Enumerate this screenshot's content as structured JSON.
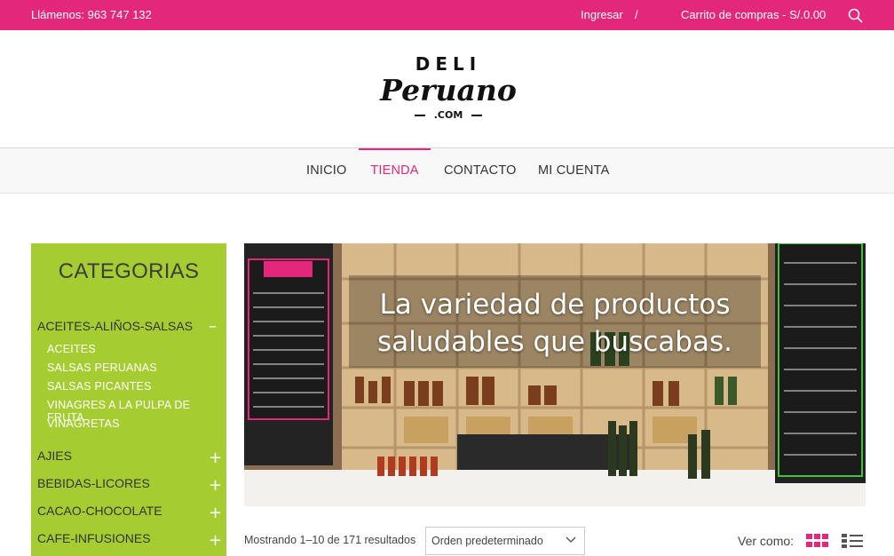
{
  "topbar": {
    "phone": "Llámenos: 963 747 132",
    "login": "Ingresar",
    "separator": "/",
    "cart": "Carrito de compras - S/.0.00",
    "search_icon": "search-icon"
  },
  "logo": {
    "line1": "DELI",
    "line2": "Peruano",
    "line3": ".COM"
  },
  "nav": {
    "items": [
      {
        "label": "INICIO"
      },
      {
        "label": "TIENDA"
      },
      {
        "label": "CONTACTO"
      },
      {
        "label": "MI CUENTA"
      }
    ],
    "active": "TIENDA"
  },
  "sidebar": {
    "title": "CATEGORIAS",
    "categories": [
      {
        "label": "ACEITES-ALIÑOS-SALSAS",
        "toggle": "–",
        "expanded": true,
        "subs": [
          "ACEITES",
          "SALSAS PERUANAS",
          "SALSAS PICANTES",
          "VINAGRES A LA PULPA DE FRUTA",
          "VINAGRETAS"
        ]
      },
      {
        "label": "AJIES",
        "toggle": "+"
      },
      {
        "label": "BEBIDAS-LICORES",
        "toggle": "+"
      },
      {
        "label": "CACAO-CHOCOLATE",
        "toggle": "+"
      },
      {
        "label": "CAFE-INFUSIONES",
        "toggle": "+"
      }
    ]
  },
  "banner": {
    "headline_line1": "La variedad de productos",
    "headline_line2": "saludables que buscabas."
  },
  "shop": {
    "results": "Mostrando 1–10 de 171 resultados",
    "order_selected": "Orden predeterminado",
    "view_label": "Ver como:"
  },
  "colors": {
    "brand_pink": "#e3277a",
    "sidebar_green": "#a5cd31"
  }
}
